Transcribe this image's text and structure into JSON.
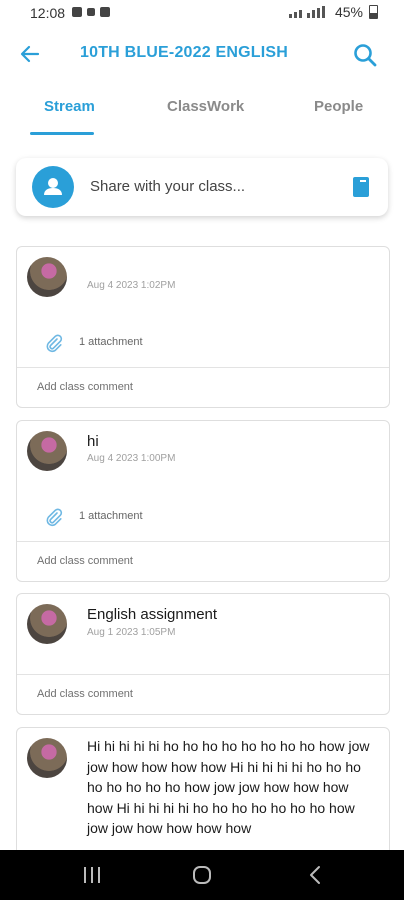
{
  "status_bar": {
    "time": "12:08",
    "battery": "45%"
  },
  "app_bar": {
    "title": "10TH BLUE-2022 ENGLISH"
  },
  "tabs": [
    {
      "label": "Stream",
      "active": true
    },
    {
      "label": "ClassWork",
      "active": false
    },
    {
      "label": "People",
      "active": false
    }
  ],
  "share": {
    "placeholder": "Share with your class..."
  },
  "posts": [
    {
      "text": "",
      "date": "Aug 4 2023 1:02PM",
      "attachment": "1 attachment",
      "comment": "Add class comment"
    },
    {
      "text": "hi",
      "date": "Aug 4 2023 1:00PM",
      "attachment": "1 attachment",
      "comment": "Add class comment"
    },
    {
      "text": "English assignment",
      "date": "Aug 1 2023 1:05PM",
      "comment": "Add class comment"
    },
    {
      "text": "Hi hi hi hi hi ho ho ho ho ho ho ho ho how jow jow how how how how Hi hi hi hi hi ho ho ho ho ho ho ho ho how jow jow how how how how Hi hi hi hi hi ho ho ho ho ho ho ho how jow jow how how how how"
    }
  ],
  "colors": {
    "accent": "#2a9fd8",
    "nav_bar": "#000000"
  },
  "icons": [
    "back-arrow-icon",
    "search-icon",
    "person-icon",
    "book-icon",
    "paperclip-icon",
    "recent-apps-icon",
    "home-icon",
    "nav-back-icon"
  ]
}
